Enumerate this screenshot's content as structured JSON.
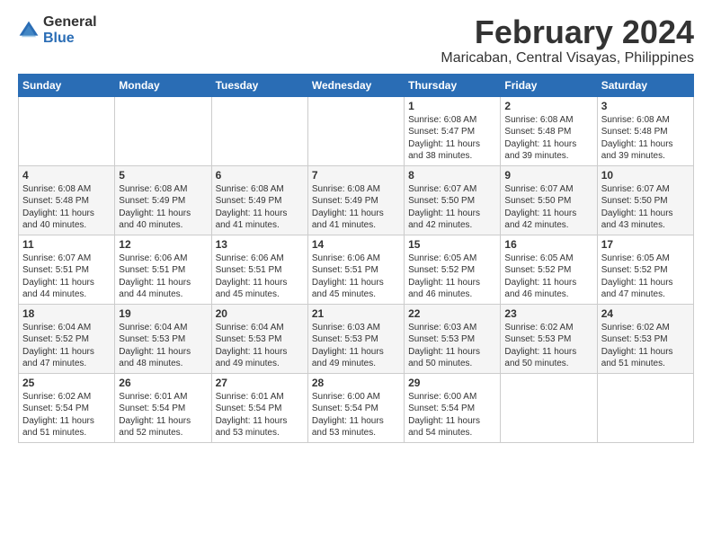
{
  "logo": {
    "general": "General",
    "blue": "Blue"
  },
  "header": {
    "title": "February 2024",
    "subtitle": "Maricaban, Central Visayas, Philippines"
  },
  "days": [
    "Sunday",
    "Monday",
    "Tuesday",
    "Wednesday",
    "Thursday",
    "Friday",
    "Saturday"
  ],
  "weeks": [
    [
      {
        "date": "",
        "info": ""
      },
      {
        "date": "",
        "info": ""
      },
      {
        "date": "",
        "info": ""
      },
      {
        "date": "",
        "info": ""
      },
      {
        "date": "1",
        "info": "Sunrise: 6:08 AM\nSunset: 5:47 PM\nDaylight: 11 hours\nand 38 minutes."
      },
      {
        "date": "2",
        "info": "Sunrise: 6:08 AM\nSunset: 5:48 PM\nDaylight: 11 hours\nand 39 minutes."
      },
      {
        "date": "3",
        "info": "Sunrise: 6:08 AM\nSunset: 5:48 PM\nDaylight: 11 hours\nand 39 minutes."
      }
    ],
    [
      {
        "date": "4",
        "info": "Sunrise: 6:08 AM\nSunset: 5:48 PM\nDaylight: 11 hours\nand 40 minutes."
      },
      {
        "date": "5",
        "info": "Sunrise: 6:08 AM\nSunset: 5:49 PM\nDaylight: 11 hours\nand 40 minutes."
      },
      {
        "date": "6",
        "info": "Sunrise: 6:08 AM\nSunset: 5:49 PM\nDaylight: 11 hours\nand 41 minutes."
      },
      {
        "date": "7",
        "info": "Sunrise: 6:08 AM\nSunset: 5:49 PM\nDaylight: 11 hours\nand 41 minutes."
      },
      {
        "date": "8",
        "info": "Sunrise: 6:07 AM\nSunset: 5:50 PM\nDaylight: 11 hours\nand 42 minutes."
      },
      {
        "date": "9",
        "info": "Sunrise: 6:07 AM\nSunset: 5:50 PM\nDaylight: 11 hours\nand 42 minutes."
      },
      {
        "date": "10",
        "info": "Sunrise: 6:07 AM\nSunset: 5:50 PM\nDaylight: 11 hours\nand 43 minutes."
      }
    ],
    [
      {
        "date": "11",
        "info": "Sunrise: 6:07 AM\nSunset: 5:51 PM\nDaylight: 11 hours\nand 44 minutes."
      },
      {
        "date": "12",
        "info": "Sunrise: 6:06 AM\nSunset: 5:51 PM\nDaylight: 11 hours\nand 44 minutes."
      },
      {
        "date": "13",
        "info": "Sunrise: 6:06 AM\nSunset: 5:51 PM\nDaylight: 11 hours\nand 45 minutes."
      },
      {
        "date": "14",
        "info": "Sunrise: 6:06 AM\nSunset: 5:51 PM\nDaylight: 11 hours\nand 45 minutes."
      },
      {
        "date": "15",
        "info": "Sunrise: 6:05 AM\nSunset: 5:52 PM\nDaylight: 11 hours\nand 46 minutes."
      },
      {
        "date": "16",
        "info": "Sunrise: 6:05 AM\nSunset: 5:52 PM\nDaylight: 11 hours\nand 46 minutes."
      },
      {
        "date": "17",
        "info": "Sunrise: 6:05 AM\nSunset: 5:52 PM\nDaylight: 11 hours\nand 47 minutes."
      }
    ],
    [
      {
        "date": "18",
        "info": "Sunrise: 6:04 AM\nSunset: 5:52 PM\nDaylight: 11 hours\nand 47 minutes."
      },
      {
        "date": "19",
        "info": "Sunrise: 6:04 AM\nSunset: 5:53 PM\nDaylight: 11 hours\nand 48 minutes."
      },
      {
        "date": "20",
        "info": "Sunrise: 6:04 AM\nSunset: 5:53 PM\nDaylight: 11 hours\nand 49 minutes."
      },
      {
        "date": "21",
        "info": "Sunrise: 6:03 AM\nSunset: 5:53 PM\nDaylight: 11 hours\nand 49 minutes."
      },
      {
        "date": "22",
        "info": "Sunrise: 6:03 AM\nSunset: 5:53 PM\nDaylight: 11 hours\nand 50 minutes."
      },
      {
        "date": "23",
        "info": "Sunrise: 6:02 AM\nSunset: 5:53 PM\nDaylight: 11 hours\nand 50 minutes."
      },
      {
        "date": "24",
        "info": "Sunrise: 6:02 AM\nSunset: 5:53 PM\nDaylight: 11 hours\nand 51 minutes."
      }
    ],
    [
      {
        "date": "25",
        "info": "Sunrise: 6:02 AM\nSunset: 5:54 PM\nDaylight: 11 hours\nand 51 minutes."
      },
      {
        "date": "26",
        "info": "Sunrise: 6:01 AM\nSunset: 5:54 PM\nDaylight: 11 hours\nand 52 minutes."
      },
      {
        "date": "27",
        "info": "Sunrise: 6:01 AM\nSunset: 5:54 PM\nDaylight: 11 hours\nand 53 minutes."
      },
      {
        "date": "28",
        "info": "Sunrise: 6:00 AM\nSunset: 5:54 PM\nDaylight: 11 hours\nand 53 minutes."
      },
      {
        "date": "29",
        "info": "Sunrise: 6:00 AM\nSunset: 5:54 PM\nDaylight: 11 hours\nand 54 minutes."
      },
      {
        "date": "",
        "info": ""
      },
      {
        "date": "",
        "info": ""
      }
    ]
  ]
}
